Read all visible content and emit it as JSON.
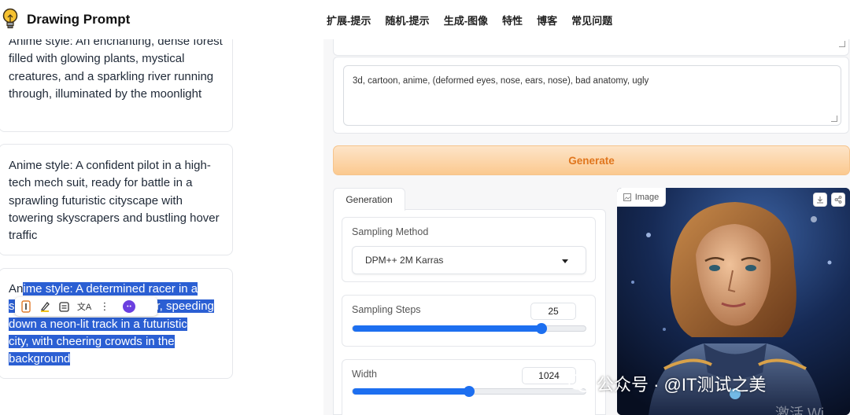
{
  "header": {
    "app_title": "Drawing Prompt",
    "logo_icon": "lightbulb-icon",
    "nav": [
      "扩展-提示",
      "随机-提示",
      "生成-图像",
      "特性",
      "博客",
      "常见问题"
    ]
  },
  "prompts": {
    "card1": "Anime style: An enchanting, dense forest filled with glowing plants, mystical creatures, and a sparkling river running through, illuminated by the moonlight",
    "card2": "Anime style: A confident pilot in a high-tech mech suit, ready for battle in a sprawling futuristic cityscape with towering skyscrapers and bustling hover traffic",
    "card3_l1_plain": "An",
    "card3_l1_sel": "ime style: A determined racer in a",
    "card3_l2_a": "s",
    "card3_l2_b": "r, speeding",
    "card3_l3": "down a neon-lit track in a futuristic",
    "card3_l4": "city, with cheering crowds in the",
    "card3_l5": "background"
  },
  "text_toolbar": {
    "icons": [
      "text-cursor-icon",
      "highlighter-icon",
      "note-icon",
      "translate-icon",
      "more-icon",
      "assistant-icon"
    ],
    "translate_glyph": "文A",
    "more_glyph": "⋮"
  },
  "negative_prompt": {
    "value": "3d, cartoon, anime, (deformed eyes, nose, ears, nose), bad anatomy, ugly"
  },
  "generate_button": "Generate",
  "tabs": {
    "generation": "Generation"
  },
  "sampling_method": {
    "label": "Sampling Method",
    "value": "DPM++ 2M Karras"
  },
  "sampling_steps": {
    "label": "Sampling Steps",
    "value": "25",
    "fill_fraction": 0.81
  },
  "width": {
    "label": "Width",
    "value": "1024",
    "fill_fraction": 0.5
  },
  "image_panel": {
    "label": "Image",
    "buttons": [
      "download-icon",
      "share-icon"
    ]
  },
  "watermark": {
    "text": "公众号 · @IT测试之美",
    "subtext": "激活 Wi"
  },
  "colors": {
    "accent": "#1d6ff0",
    "generate_text": "#e0761d",
    "selection": "#2b5fd3"
  }
}
